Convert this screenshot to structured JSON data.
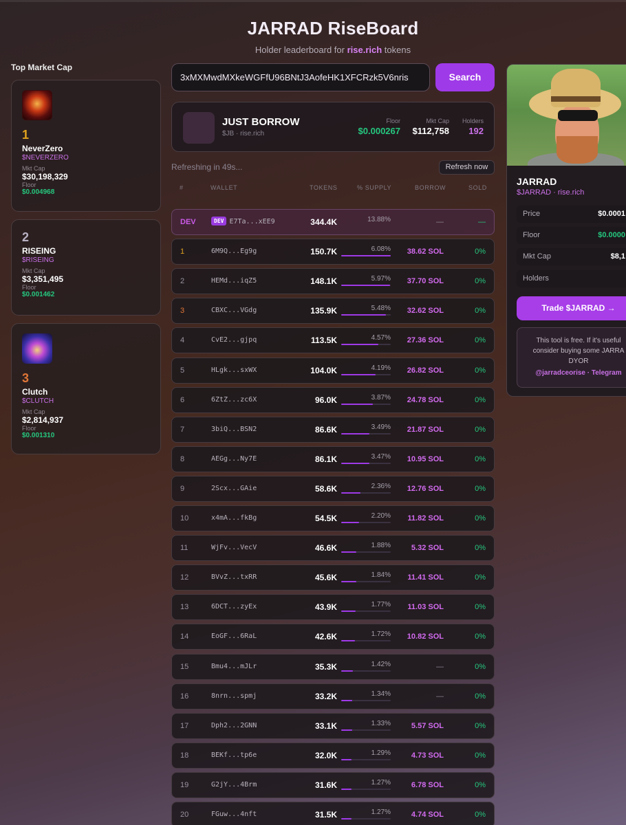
{
  "header": {
    "title": "JARRAD RiseBoard",
    "subtitle_prefix": "Holder leaderboard for ",
    "subtitle_link": "rise.rich",
    "subtitle_suffix": " tokens"
  },
  "left_panel": {
    "title": "Top Market Cap",
    "cards": [
      {
        "rank": "1",
        "name": "NeverZero",
        "ticker": "$NEVERZERO",
        "mktcap_label": "Mkt Cap",
        "mktcap": "$30,198,329",
        "floor_label": "Floor",
        "floor": "$0.004968",
        "rank_color": "#e0a21e"
      },
      {
        "rank": "2",
        "name": "RISEING",
        "ticker": "$RISEING",
        "mktcap_label": "Mkt Cap",
        "mktcap": "$3,351,495",
        "floor_label": "Floor",
        "floor": "$0.001462",
        "rank_color": "#b9b2c4"
      },
      {
        "rank": "3",
        "name": "Clutch",
        "ticker": "$CLUTCH",
        "mktcap_label": "Mkt Cap",
        "mktcap": "$2,814,937",
        "floor_label": "Floor",
        "floor": "$0.001310",
        "rank_color": "#e07636"
      }
    ]
  },
  "search": {
    "value": "3xMXMwdMXkeWGFfU96BNtJ3AofeHK1XFCRzk5V6nris",
    "button_label": "Search"
  },
  "token": {
    "name": "JUST BORROW",
    "sub": "$JB · rise.rich",
    "floor_label": "Floor",
    "floor": "$0.000267",
    "mktcap_label": "Mkt Cap",
    "mktcap": "$112,758",
    "holders_label": "Holders",
    "holders": "192"
  },
  "refresh": {
    "status": "Refreshing in 49s...",
    "button_label": "Refresh now"
  },
  "table": {
    "headers": {
      "rank": "#",
      "wallet": "WALLET",
      "tokens": "TOKENS",
      "supply": "% SUPPLY",
      "borrow": "BORROW",
      "sold": "SOLD"
    },
    "dev_badge": "DEV",
    "rows": [
      {
        "rank": "DEV",
        "wallet": "E7Ta...xEE9",
        "tokens": "344.4K",
        "supply": "13.88%",
        "supply_pct": 13.88,
        "borrow": "—",
        "sold": "—",
        "dev": true
      },
      {
        "rank": "1",
        "wallet": "6M9Q...Eg9g",
        "tokens": "150.7K",
        "supply": "6.08%",
        "supply_pct": 6.08,
        "borrow": "38.62 SOL",
        "sold": "0%"
      },
      {
        "rank": "2",
        "wallet": "HEMd...iqZ5",
        "tokens": "148.1K",
        "supply": "5.97%",
        "supply_pct": 5.97,
        "borrow": "37.70 SOL",
        "sold": "0%"
      },
      {
        "rank": "3",
        "wallet": "CBXC...VGdg",
        "tokens": "135.9K",
        "supply": "5.48%",
        "supply_pct": 5.48,
        "borrow": "32.62 SOL",
        "sold": "0%"
      },
      {
        "rank": "4",
        "wallet": "CvE2...gjpq",
        "tokens": "113.5K",
        "supply": "4.57%",
        "supply_pct": 4.57,
        "borrow": "27.36 SOL",
        "sold": "0%"
      },
      {
        "rank": "5",
        "wallet": "HLgk...sxWX",
        "tokens": "104.0K",
        "supply": "4.19%",
        "supply_pct": 4.19,
        "borrow": "26.82 SOL",
        "sold": "0%"
      },
      {
        "rank": "6",
        "wallet": "6ZtZ...zc6X",
        "tokens": "96.0K",
        "supply": "3.87%",
        "supply_pct": 3.87,
        "borrow": "24.78 SOL",
        "sold": "0%"
      },
      {
        "rank": "7",
        "wallet": "3biQ...BSN2",
        "tokens": "86.6K",
        "supply": "3.49%",
        "supply_pct": 3.49,
        "borrow": "21.87 SOL",
        "sold": "0%"
      },
      {
        "rank": "8",
        "wallet": "AEGg...Ny7E",
        "tokens": "86.1K",
        "supply": "3.47%",
        "supply_pct": 3.47,
        "borrow": "10.95 SOL",
        "sold": "0%"
      },
      {
        "rank": "9",
        "wallet": "2Scx...GAie",
        "tokens": "58.6K",
        "supply": "2.36%",
        "supply_pct": 2.36,
        "borrow": "12.76 SOL",
        "sold": "0%"
      },
      {
        "rank": "10",
        "wallet": "x4mA...fkBg",
        "tokens": "54.5K",
        "supply": "2.20%",
        "supply_pct": 2.2,
        "borrow": "11.82 SOL",
        "sold": "0%"
      },
      {
        "rank": "11",
        "wallet": "WjFv...VecV",
        "tokens": "46.6K",
        "supply": "1.88%",
        "supply_pct": 1.88,
        "borrow": "5.32 SOL",
        "sold": "0%"
      },
      {
        "rank": "12",
        "wallet": "BVvZ...txRR",
        "tokens": "45.6K",
        "supply": "1.84%",
        "supply_pct": 1.84,
        "borrow": "11.41 SOL",
        "sold": "0%"
      },
      {
        "rank": "13",
        "wallet": "6DCT...zyEx",
        "tokens": "43.9K",
        "supply": "1.77%",
        "supply_pct": 1.77,
        "borrow": "11.03 SOL",
        "sold": "0%"
      },
      {
        "rank": "14",
        "wallet": "EoGF...6RaL",
        "tokens": "42.6K",
        "supply": "1.72%",
        "supply_pct": 1.72,
        "borrow": "10.82 SOL",
        "sold": "0%"
      },
      {
        "rank": "15",
        "wallet": "Bmu4...mJLr",
        "tokens": "35.3K",
        "supply": "1.42%",
        "supply_pct": 1.42,
        "borrow": "—",
        "sold": "0%"
      },
      {
        "rank": "16",
        "wallet": "8nrn...spmj",
        "tokens": "33.2K",
        "supply": "1.34%",
        "supply_pct": 1.34,
        "borrow": "—",
        "sold": "0%"
      },
      {
        "rank": "17",
        "wallet": "Dph2...2GNN",
        "tokens": "33.1K",
        "supply": "1.33%",
        "supply_pct": 1.33,
        "borrow": "5.57 SOL",
        "sold": "0%"
      },
      {
        "rank": "18",
        "wallet": "BEKf...tp6e",
        "tokens": "32.0K",
        "supply": "1.29%",
        "supply_pct": 1.29,
        "borrow": "4.73 SOL",
        "sold": "0%"
      },
      {
        "rank": "19",
        "wallet": "G2jY...4Brm",
        "tokens": "31.6K",
        "supply": "1.27%",
        "supply_pct": 1.27,
        "borrow": "6.78 SOL",
        "sold": "0%"
      },
      {
        "rank": "20",
        "wallet": "FGuw...4nft",
        "tokens": "31.5K",
        "supply": "1.27%",
        "supply_pct": 1.27,
        "borrow": "4.74 SOL",
        "sold": "0%"
      }
    ]
  },
  "profile": {
    "name": "JARRAD",
    "sub": "$JARRAD · rise.rich",
    "stats": [
      {
        "label": "Price",
        "value": "$0.0001",
        "color": "#ffffff"
      },
      {
        "label": "Floor",
        "value": "$0.0000",
        "color": "#25c77e"
      },
      {
        "label": "Mkt Cap",
        "value": "$8,1",
        "color": "#ffffff"
      },
      {
        "label": "Holders",
        "value": "",
        "color": "#ffffff"
      }
    ],
    "trade_label": "Trade $JARRAD →",
    "note_line1": "This tool is free. If it's useful",
    "note_line2": "consider buying some JARRA",
    "note_line3": "DYOR",
    "note_links": "@jarradceorise · Telegram"
  },
  "colors": {
    "accent": "#9f3ae8",
    "green": "#25c77e",
    "borrow": "#d36bf0",
    "gold": "#e0a21e",
    "bronze": "#e07636"
  }
}
